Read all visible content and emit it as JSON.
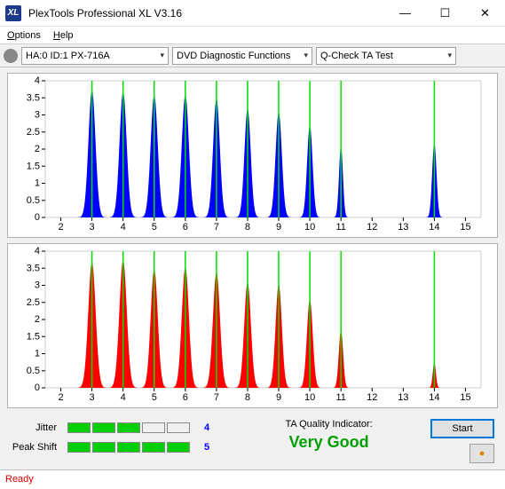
{
  "window": {
    "title": "PlexTools Professional XL V3.16"
  },
  "menu": {
    "options": "Options",
    "help": "Help"
  },
  "toolbar": {
    "drive": "HA:0 ID:1   PX-716A",
    "func": "DVD Diagnostic Functions",
    "test": "Q-Check TA Test"
  },
  "quality": {
    "jitter": {
      "label": "Jitter",
      "value": "4",
      "filled": 3,
      "color": "#0000ff"
    },
    "peak": {
      "label": "Peak Shift",
      "value": "5",
      "filled": 5,
      "color": "#0000ff"
    },
    "indicator_label": "TA Quality Indicator:",
    "indicator_value": "Very Good"
  },
  "buttons": {
    "start": "Start"
  },
  "status": {
    "text": "Ready"
  },
  "chart_data": [
    {
      "type": "area",
      "color": "#0000ff",
      "xlabel": "",
      "ylabel": "",
      "xlim": [
        1.5,
        15.5
      ],
      "ylim": [
        0,
        4
      ],
      "xticks": [
        2,
        3,
        4,
        5,
        6,
        7,
        8,
        9,
        10,
        11,
        12,
        13,
        14,
        15
      ],
      "yticks": [
        0,
        0.5,
        1,
        1.5,
        2,
        2.5,
        3,
        3.5,
        4
      ],
      "green_lines": [
        3,
        4,
        5,
        6,
        7,
        8,
        9,
        10,
        11,
        14
      ],
      "peaks": [
        {
          "center": 3,
          "height": 3.75,
          "width": 0.9
        },
        {
          "center": 4,
          "height": 3.7,
          "width": 0.9
        },
        {
          "center": 5,
          "height": 3.6,
          "width": 0.9
        },
        {
          "center": 6,
          "height": 3.6,
          "width": 0.9
        },
        {
          "center": 7,
          "height": 3.5,
          "width": 0.85
        },
        {
          "center": 8,
          "height": 3.2,
          "width": 0.8
        },
        {
          "center": 9,
          "height": 3.1,
          "width": 0.8
        },
        {
          "center": 10,
          "height": 2.7,
          "width": 0.7
        },
        {
          "center": 11,
          "height": 2.1,
          "width": 0.5
        },
        {
          "center": 14,
          "height": 2.2,
          "width": 0.55
        }
      ]
    },
    {
      "type": "area",
      "color": "#ff0000",
      "xlabel": "",
      "ylabel": "",
      "xlim": [
        1.5,
        15.5
      ],
      "ylim": [
        0,
        4
      ],
      "xticks": [
        2,
        3,
        4,
        5,
        6,
        7,
        8,
        9,
        10,
        11,
        12,
        13,
        14,
        15
      ],
      "yticks": [
        0,
        0.5,
        1,
        1.5,
        2,
        2.5,
        3,
        3.5,
        4
      ],
      "green_lines": [
        3,
        4,
        5,
        6,
        7,
        8,
        9,
        10,
        11,
        14
      ],
      "peaks": [
        {
          "center": 3,
          "height": 3.7,
          "width": 0.95
        },
        {
          "center": 4,
          "height": 3.75,
          "width": 0.95
        },
        {
          "center": 5,
          "height": 3.5,
          "width": 0.9
        },
        {
          "center": 6,
          "height": 3.55,
          "width": 0.9
        },
        {
          "center": 7,
          "height": 3.4,
          "width": 0.9
        },
        {
          "center": 8,
          "height": 3.1,
          "width": 0.85
        },
        {
          "center": 9,
          "height": 3.05,
          "width": 0.8
        },
        {
          "center": 10,
          "height": 2.6,
          "width": 0.75
        },
        {
          "center": 11,
          "height": 1.7,
          "width": 0.55
        },
        {
          "center": 14,
          "height": 0.75,
          "width": 0.4
        }
      ]
    }
  ]
}
